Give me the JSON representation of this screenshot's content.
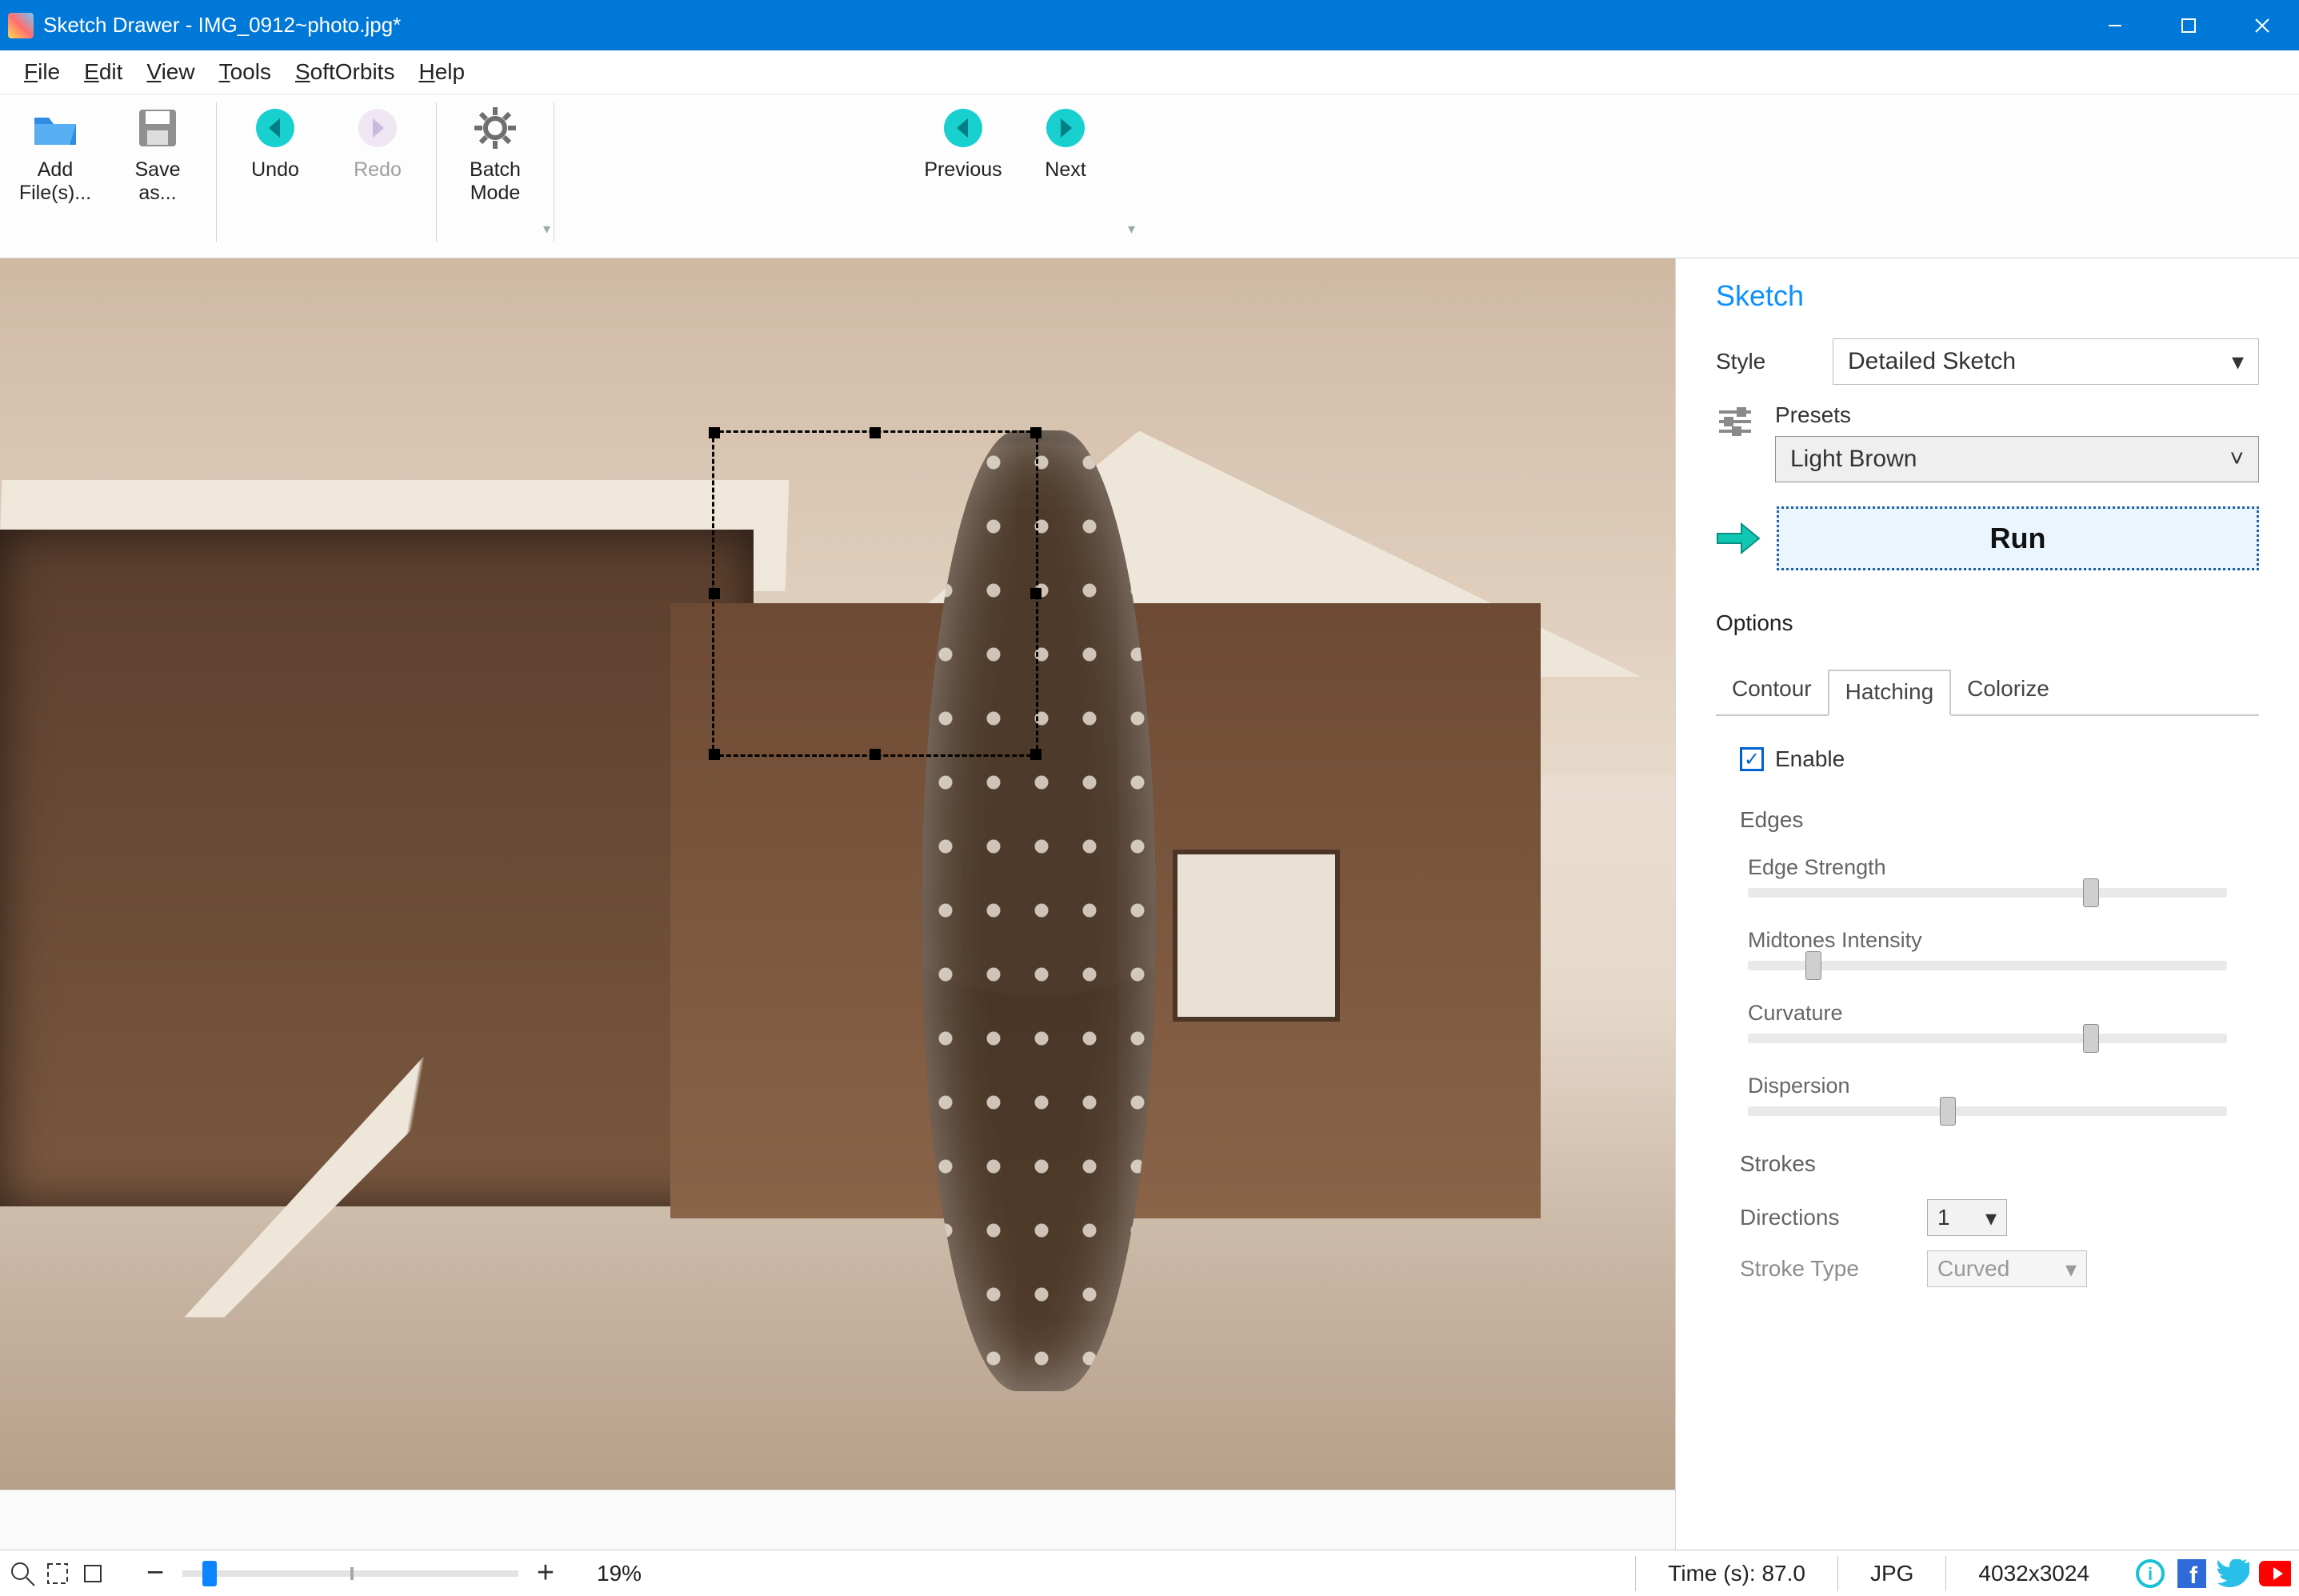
{
  "titlebar": {
    "title": "Sketch Drawer - IMG_0912~photo.jpg*"
  },
  "menu": {
    "file": "File",
    "edit": "Edit",
    "view": "View",
    "tools": "Tools",
    "softorbits": "SoftOrbits",
    "help": "Help"
  },
  "toolbar": {
    "add_files": "Add File(s)...",
    "save_as": "Save as...",
    "undo": "Undo",
    "redo": "Redo",
    "batch_mode": "Batch Mode",
    "previous": "Previous",
    "next": "Next"
  },
  "panel": {
    "heading": "Sketch",
    "style_label": "Style",
    "style_value": "Detailed Sketch",
    "presets_label": "Presets",
    "presets_value": "Light Brown",
    "run": "Run",
    "options": "Options",
    "tabs": {
      "contour": "Contour",
      "hatching": "Hatching",
      "colorize": "Colorize"
    },
    "enable": "Enable",
    "edges": "Edges",
    "edge_strength": "Edge Strength",
    "midtones": "Midtones Intensity",
    "curvature": "Curvature",
    "dispersion": "Dispersion",
    "strokes": "Strokes",
    "directions": "Directions",
    "directions_value": "1",
    "stroke_type": "Stroke Type",
    "stroke_type_value": "Curved",
    "sliders": {
      "edge_strength": 70,
      "midtones": 12,
      "curvature": 70,
      "dispersion": 40
    }
  },
  "status": {
    "zoom_pct": "19%",
    "time": "Time (s): 87.0",
    "format": "JPG",
    "dimensions": "4032x3024"
  }
}
